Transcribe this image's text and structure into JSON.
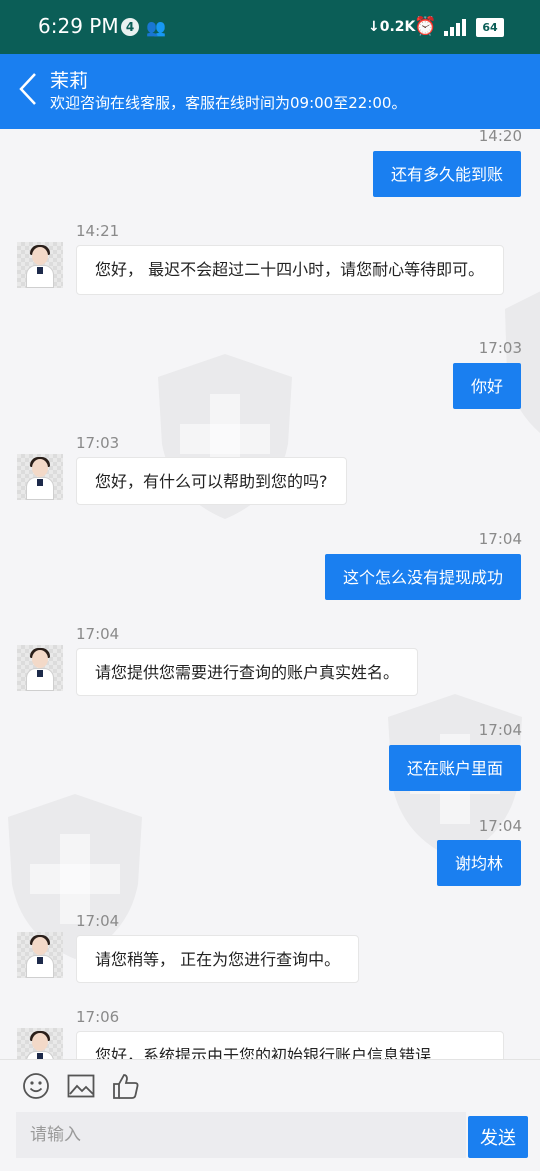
{
  "status_bar": {
    "time": "6:29 PM",
    "notification_count": "4",
    "network_speed": "↓0.2K",
    "network_type": "4G",
    "battery": "64"
  },
  "header": {
    "title": "茉莉",
    "subtitle": "欢迎咨询在线客服，客服在线时间为09:00至22:00。"
  },
  "messages": [
    {
      "side": "out",
      "time": "14:20",
      "text": "还有多久能到账"
    },
    {
      "side": "in",
      "time": "14:21",
      "text": "您好， 最迟不会超过二十四小时，请您耐心等待即可。"
    },
    {
      "side": "out",
      "time": "17:03",
      "text": "你好"
    },
    {
      "side": "in",
      "time": "17:03",
      "text": "您好，有什么可以帮助到您的吗?"
    },
    {
      "side": "out",
      "time": "17:04",
      "text": "这个怎么没有提现成功"
    },
    {
      "side": "in",
      "time": "17:04",
      "text": "请您提供您需要进行查询的账户真实姓名。"
    },
    {
      "side": "out",
      "time": "17:04",
      "text": "还在账户里面"
    },
    {
      "side": "out",
      "time": "17:04",
      "text": "谢均林"
    },
    {
      "side": "in",
      "time": "17:04",
      "text": "请您稍等， 正在为您进行查询中。"
    },
    {
      "side": "in",
      "time": "17:06",
      "text": "您好，系统提示由于您的初始银行账户信息错误"
    }
  ],
  "input": {
    "placeholder": "请输入",
    "send_label": "发送"
  },
  "icons": {
    "emoji": "smiley-icon",
    "image": "image-icon",
    "like": "thumbs-up-icon"
  },
  "colors": {
    "status_bar": "#0b5e57",
    "header": "#1a7ff0",
    "outgoing_bubble": "#1a7ff0",
    "incoming_bubble": "#ffffff"
  }
}
